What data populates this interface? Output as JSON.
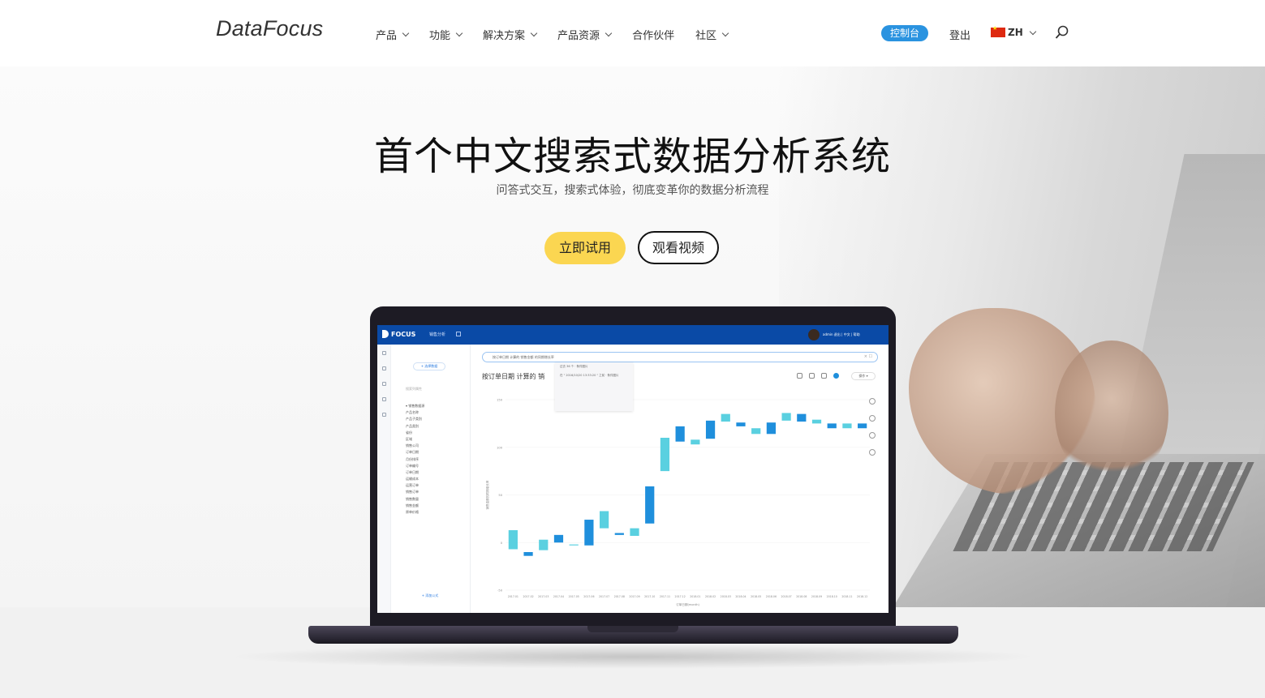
{
  "header": {
    "logo": "DataFocus",
    "nav": [
      {
        "label": "产品",
        "dropdown": true
      },
      {
        "label": "功能",
        "dropdown": true
      },
      {
        "label": "解决方案",
        "dropdown": true
      },
      {
        "label": "产品资源",
        "dropdown": true
      },
      {
        "label": "合作伙伴",
        "dropdown": false
      },
      {
        "label": "社区",
        "dropdown": true
      }
    ],
    "console_label": "控制台",
    "login_label": "登出",
    "lang_label": "ZH",
    "accent_color": "#2a93e0"
  },
  "hero": {
    "title": "首个中文搜索式数据分析系统",
    "subtitle": "问答式交互，搜索式体验，彻底变革你的数据分析流程",
    "try_label": "立即试用",
    "video_label": "观看视频",
    "try_color": "#fbd651"
  },
  "app": {
    "logo": "FOCUS",
    "tab_title": "销售分析",
    "user": "admin  退出  |  中文  |  帮助",
    "side_button": "+ 选择数据",
    "side_search": "搜索列属性",
    "side_group": "▾ 销售数据源",
    "side_items": [
      "产品名称",
      "产品子类别",
      "产品类别",
      "省份",
      "区域",
      "销售公司",
      "订单日期",
      "月份排序",
      "订单编号",
      "订单日期",
      "运输成本",
      "运营订单",
      "销售订单",
      "销售数量",
      "销售金额",
      "原单价格"
    ],
    "side_bottom": "+ 添加公式",
    "search_text": "按订单日期 计算的 销售金额 的同期增长率",
    "suggest_lines": [
      "过去 36 个 · 条件图片",
      "在 \" 2016/10/20 13:33:20 \" 之前 · 条件图片"
    ],
    "chart_title": "按订单日期 计算的 销",
    "op_label": "操作 ▾"
  },
  "chart_data": {
    "type": "bar",
    "subtype": "waterfall",
    "xlabel": "订单日期(month)",
    "ylabel": "销售金额的同期增长率",
    "y_ticks": [
      "150",
      "100",
      "50",
      "0",
      "-50"
    ],
    "ylim": [
      -50,
      150
    ],
    "categories": [
      "2017.01",
      "2017.02",
      "2017.03",
      "2017.04",
      "2017.05",
      "2017.06",
      "2017.07",
      "2017.08",
      "2017.09",
      "2017.10",
      "2017.11",
      "2017.12",
      "2018.01",
      "2018.02",
      "2018.03",
      "2018.04",
      "2018.05",
      "2018.06",
      "2018.07",
      "2018.08",
      "2018.09",
      "2018.10",
      "2018.11",
      "2018.12"
    ],
    "ranges": [
      [
        -7,
        13
      ],
      [
        -14,
        -10
      ],
      [
        -8,
        3
      ],
      [
        0,
        8
      ],
      [
        -3,
        -2
      ],
      [
        -3,
        24
      ],
      [
        15,
        33
      ],
      [
        8,
        10
      ],
      [
        7,
        15
      ],
      [
        20,
        59
      ],
      [
        75,
        110
      ],
      [
        106,
        122
      ],
      [
        103,
        108
      ],
      [
        109,
        128
      ],
      [
        127,
        135
      ],
      [
        122,
        126
      ],
      [
        114,
        120
      ],
      [
        114,
        126
      ],
      [
        128,
        136
      ],
      [
        127,
        135
      ],
      [
        125,
        129
      ],
      [
        120,
        125
      ],
      [
        120,
        125
      ],
      [
        120,
        125
      ]
    ],
    "colors": {
      "light": "#5ad0e0",
      "dark": "#1f8fdc"
    },
    "grid": true
  }
}
